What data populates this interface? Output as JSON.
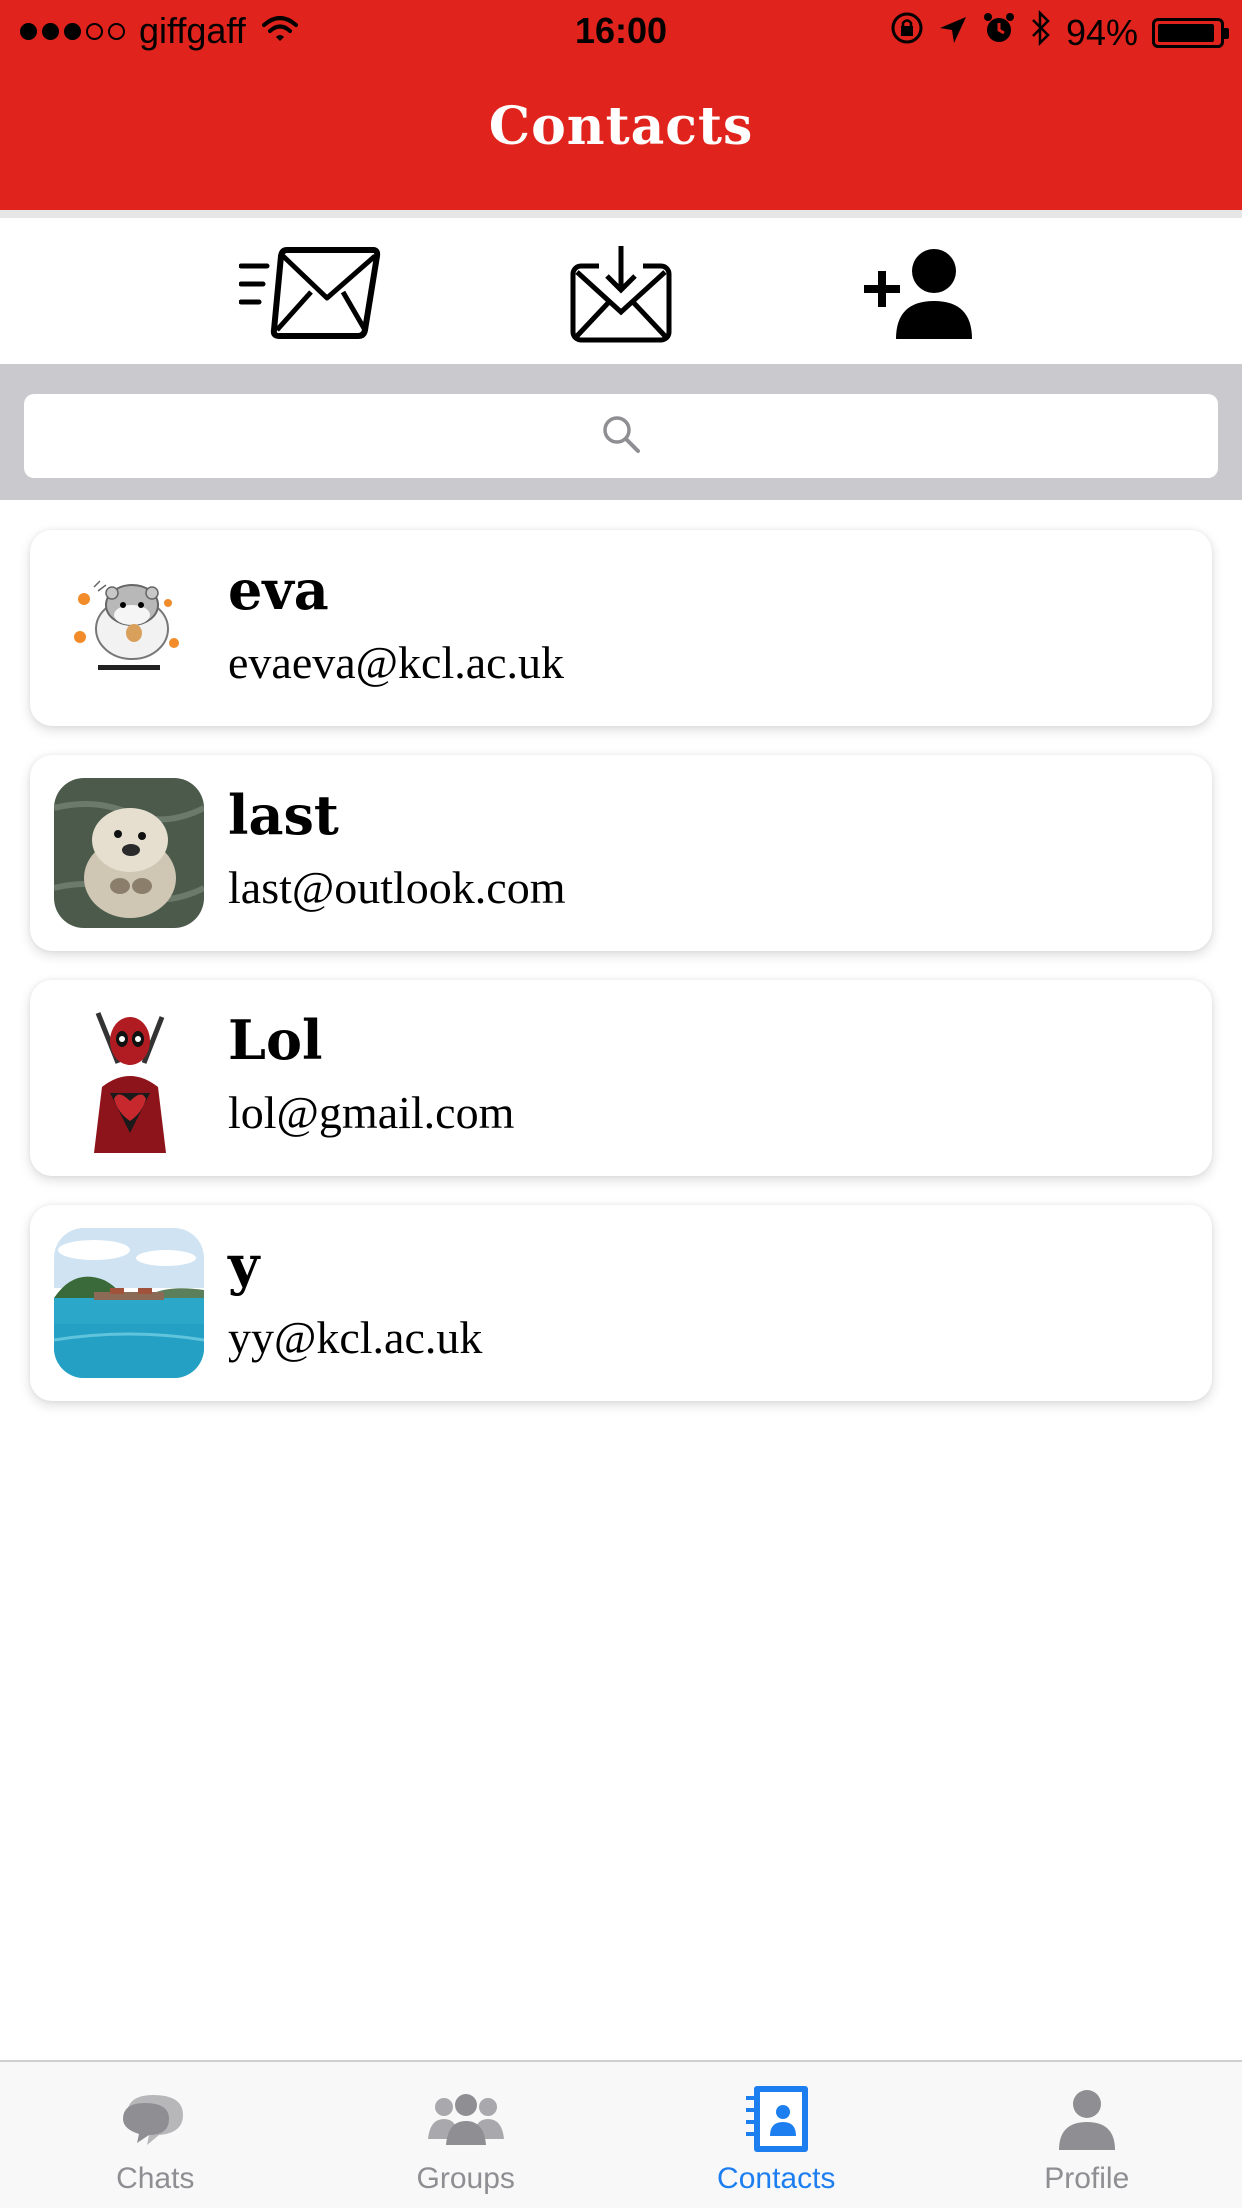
{
  "status_bar": {
    "carrier": "giffgaff",
    "signal_strength": 3,
    "signal_total": 5,
    "time": "16:00",
    "battery_percent": "94%",
    "battery_level": 0.94
  },
  "header": {
    "title": "Contacts",
    "background_color": "#e0231c"
  },
  "toolbar": {
    "buttons": [
      {
        "icon": "send-mail-icon"
      },
      {
        "icon": "inbox-download-icon"
      },
      {
        "icon": "add-contact-icon"
      }
    ]
  },
  "search": {
    "placeholder": "",
    "value": "",
    "icon": "search-icon"
  },
  "contacts": [
    {
      "name": "eva",
      "email": "evaeva@kcl.ac.uk",
      "avatar": "hamster-avatar"
    },
    {
      "name": "last",
      "email": "last@outlook.com",
      "avatar": "otter-avatar"
    },
    {
      "name": "Lol",
      "email": "lol@gmail.com",
      "avatar": "deadpool-avatar"
    },
    {
      "name": "y",
      "email": "yy@kcl.ac.uk",
      "avatar": "lake-avatar"
    }
  ],
  "tab_bar": {
    "active_color": "#1d7ef0",
    "inactive_color": "#8e8e93",
    "tabs": [
      {
        "label": "Chats",
        "icon": "chat-bubbles-icon",
        "active": false
      },
      {
        "label": "Groups",
        "icon": "group-people-icon",
        "active": false
      },
      {
        "label": "Contacts",
        "icon": "contacts-book-icon",
        "active": true
      },
      {
        "label": "Profile",
        "icon": "person-icon",
        "active": false
      }
    ]
  }
}
